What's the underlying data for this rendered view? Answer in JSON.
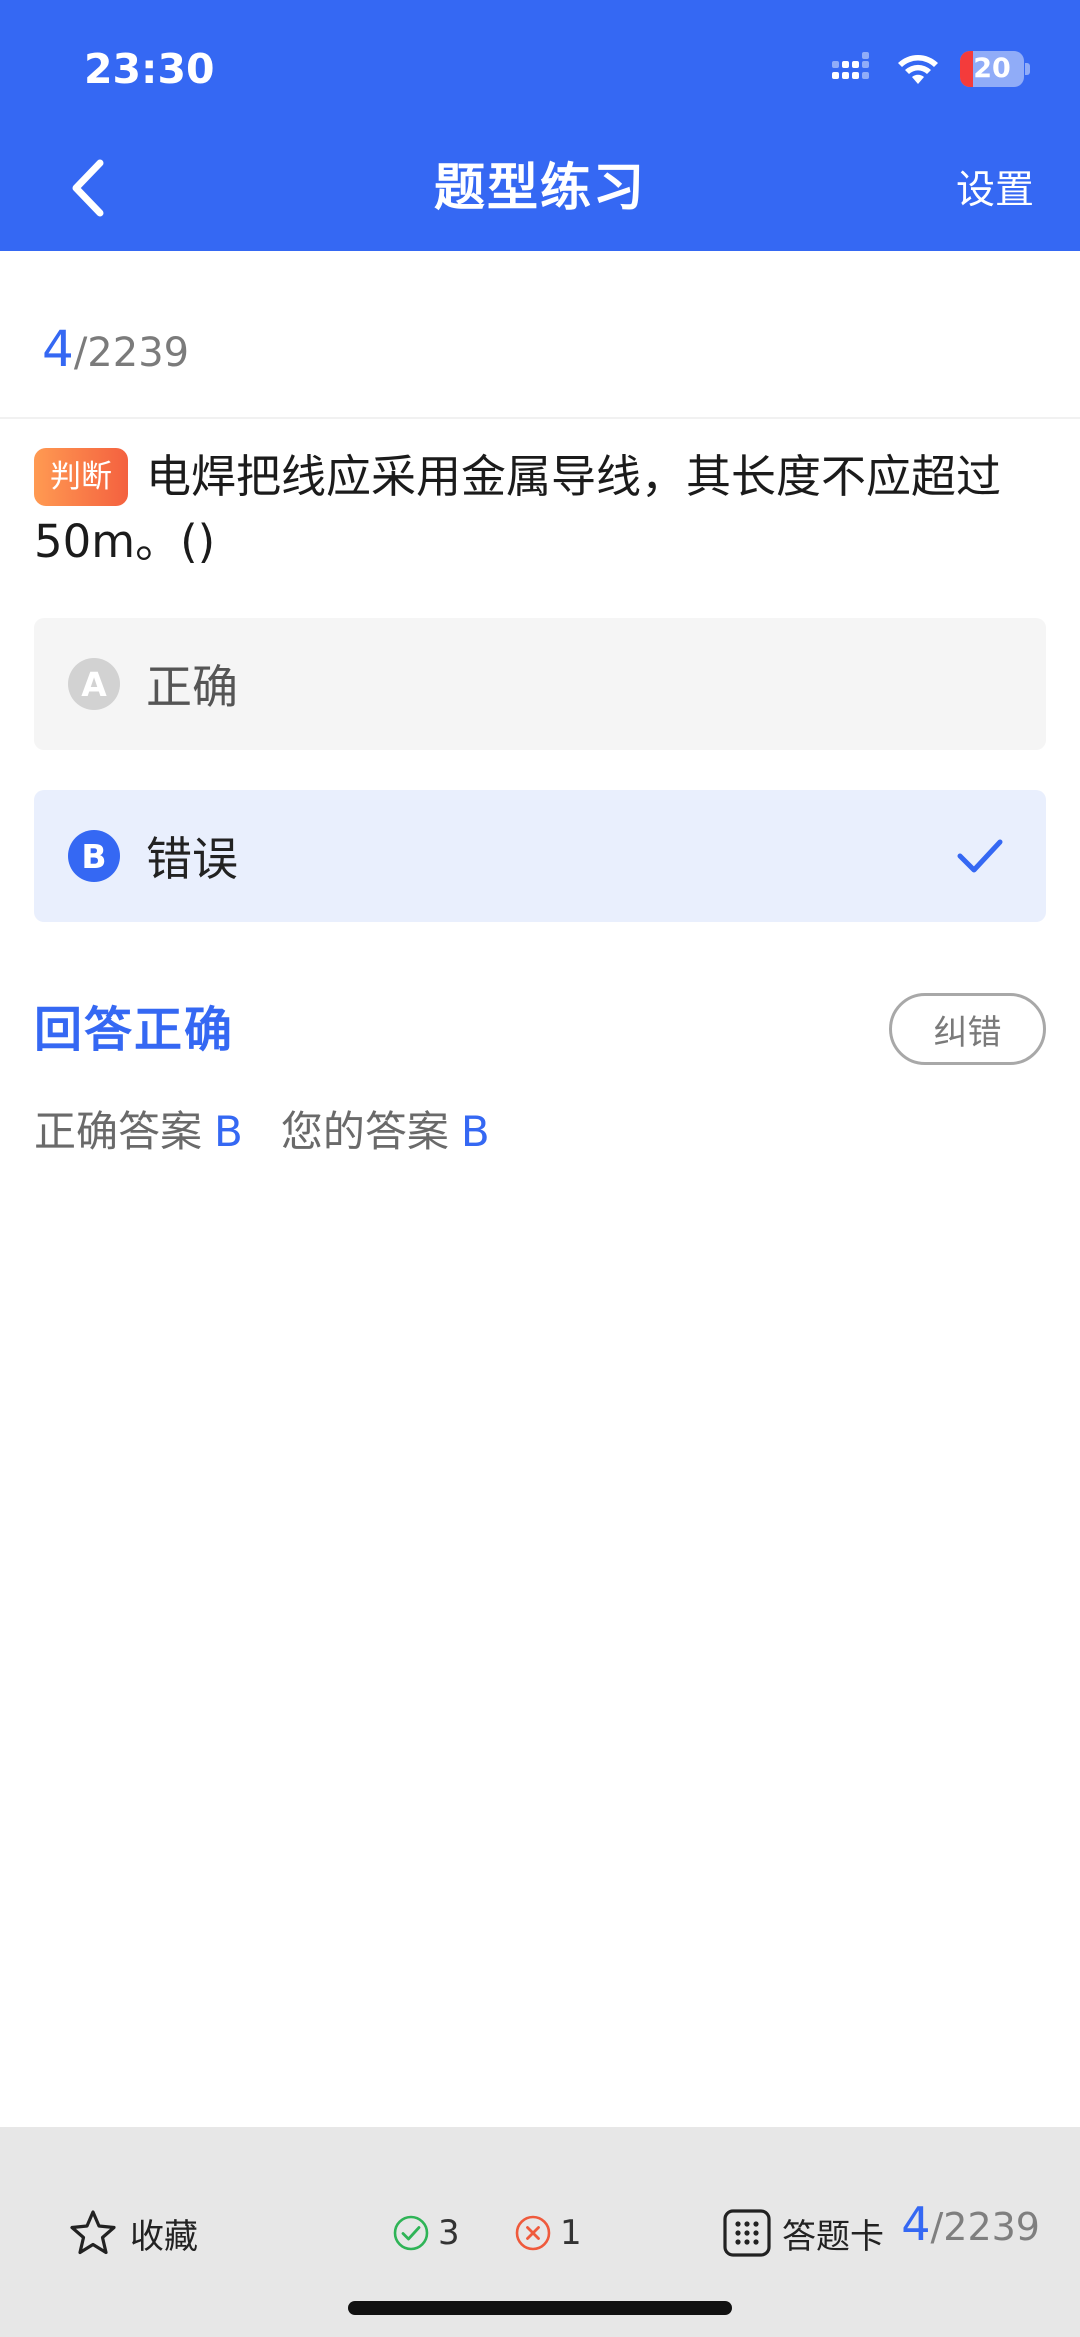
{
  "status_bar": {
    "time": "23:30",
    "battery_level": "20",
    "battery_fraction": 0.2,
    "icons": [
      "signal-icon",
      "wifi-icon",
      "battery-icon"
    ]
  },
  "nav": {
    "back_icon": "chevron-left-icon",
    "title": "题型练习",
    "settings_label": "设置"
  },
  "progress": {
    "current": "4",
    "separator": "/",
    "total": "2239"
  },
  "question": {
    "type_tag": "判断",
    "text": "电焊把线应采用金属导线，其长度不应超过50m。()"
  },
  "options": [
    {
      "letter": "A",
      "text": "正确",
      "selected": false
    },
    {
      "letter": "B",
      "text": "错误",
      "selected": true
    }
  ],
  "result": {
    "title": "回答正确",
    "report_label": "纠错",
    "correct_answer_label": "正确答案",
    "correct_answer": "B",
    "your_answer_label": "您的答案",
    "your_answer": "B"
  },
  "bottom_bar": {
    "favorite_label": "收藏",
    "right_count": "3",
    "wrong_count": "1",
    "card_label": "答题卡",
    "current": "4",
    "separator": "/",
    "total": "2239"
  },
  "colors": {
    "primary": "#3568f3",
    "tag_gradient_start": "#ff9a52",
    "tag_gradient_end": "#f4613f",
    "correct_green": "#2fb457",
    "wrong_red": "#ef5a3c"
  }
}
